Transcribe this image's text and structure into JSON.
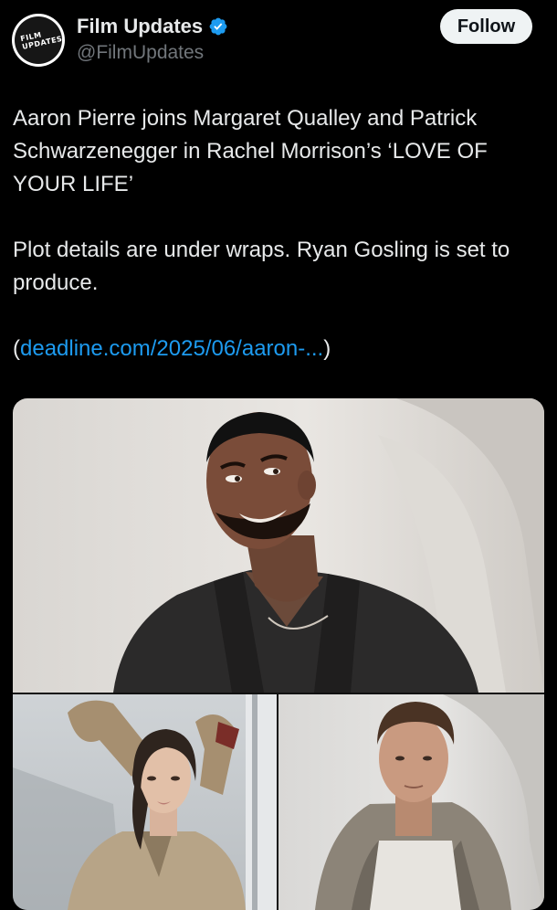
{
  "account": {
    "display_name": "Film Updates",
    "handle": "@FilmUpdates",
    "avatar_text": "FILM UPDATES",
    "verified": true
  },
  "follow_button": {
    "label": "Follow"
  },
  "post": {
    "paragraph1": "Aaron Pierre joins Margaret Qualley and Patrick Schwarzenegger in Rachel Morrison’s ‘LOVE OF YOUR LIFE’",
    "paragraph2": "Plot details are under wraps. Ryan Gosling is set to produce.",
    "link_open": "(",
    "link_text": "deadline.com/2025/06/aaron-...",
    "link_close": ")"
  },
  "colors": {
    "background": "#000000",
    "text": "#e7e9ea",
    "secondary_text": "#71767b",
    "link": "#1d9bf0",
    "verified_badge": "#1d9bf0",
    "follow_bg": "#eff3f4"
  },
  "icons": {
    "verified": "verified-badge-icon"
  }
}
